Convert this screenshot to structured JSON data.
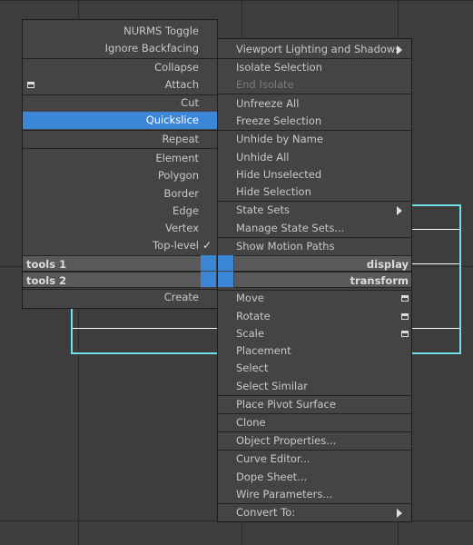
{
  "left_menu": {
    "items": [
      {
        "label": "NURMS Toggle"
      },
      {
        "label": "Ignore Backfacing"
      },
      {
        "label": "Collapse"
      },
      {
        "label": "Attach"
      },
      {
        "label": "Cut"
      },
      {
        "label": "Quickslice",
        "selected": true
      },
      {
        "label": "Repeat"
      },
      {
        "label": "Element"
      },
      {
        "label": "Polygon"
      },
      {
        "label": "Border"
      },
      {
        "label": "Edge"
      },
      {
        "label": "Vertex"
      },
      {
        "label": "Top-level",
        "checked": true
      }
    ],
    "checkmark": "✓"
  },
  "quad_headers": {
    "tools1": "tools 1",
    "tools2": "tools 2",
    "display": "display",
    "transform": "transform"
  },
  "left_bottom": {
    "create": "Create"
  },
  "right_menu": {
    "items": [
      {
        "label": "Viewport Lighting and Shadows",
        "submenu": true
      },
      {
        "label": "Isolate Selection"
      },
      {
        "label": "End Isolate",
        "disabled": true
      },
      {
        "label": "Unfreeze All"
      },
      {
        "label": "Freeze Selection"
      },
      {
        "label": "Unhide by Name"
      },
      {
        "label": "Unhide All"
      },
      {
        "label": "Hide Unselected"
      },
      {
        "label": "Hide Selection"
      },
      {
        "label": "State Sets",
        "submenu": true
      },
      {
        "label": "Manage State Sets..."
      },
      {
        "label": "Show Motion Paths"
      },
      {
        "label": "Move",
        "settings_icon": true
      },
      {
        "label": "Rotate",
        "settings_icon": true
      },
      {
        "label": "Scale",
        "settings_icon": true
      },
      {
        "label": "Placement"
      },
      {
        "label": "Select"
      },
      {
        "label": "Select Similar"
      },
      {
        "label": "Place Pivot Surface"
      },
      {
        "label": "Clone"
      },
      {
        "label": "Object Properties..."
      },
      {
        "label": "Curve Editor..."
      },
      {
        "label": "Dope Sheet..."
      },
      {
        "label": "Wire Parameters..."
      },
      {
        "label": "Convert To:",
        "submenu": true
      }
    ]
  },
  "colors": {
    "highlight": "#3b86d7",
    "viewport_outline": "#6fe0ea",
    "menu_bg": "#444444"
  }
}
